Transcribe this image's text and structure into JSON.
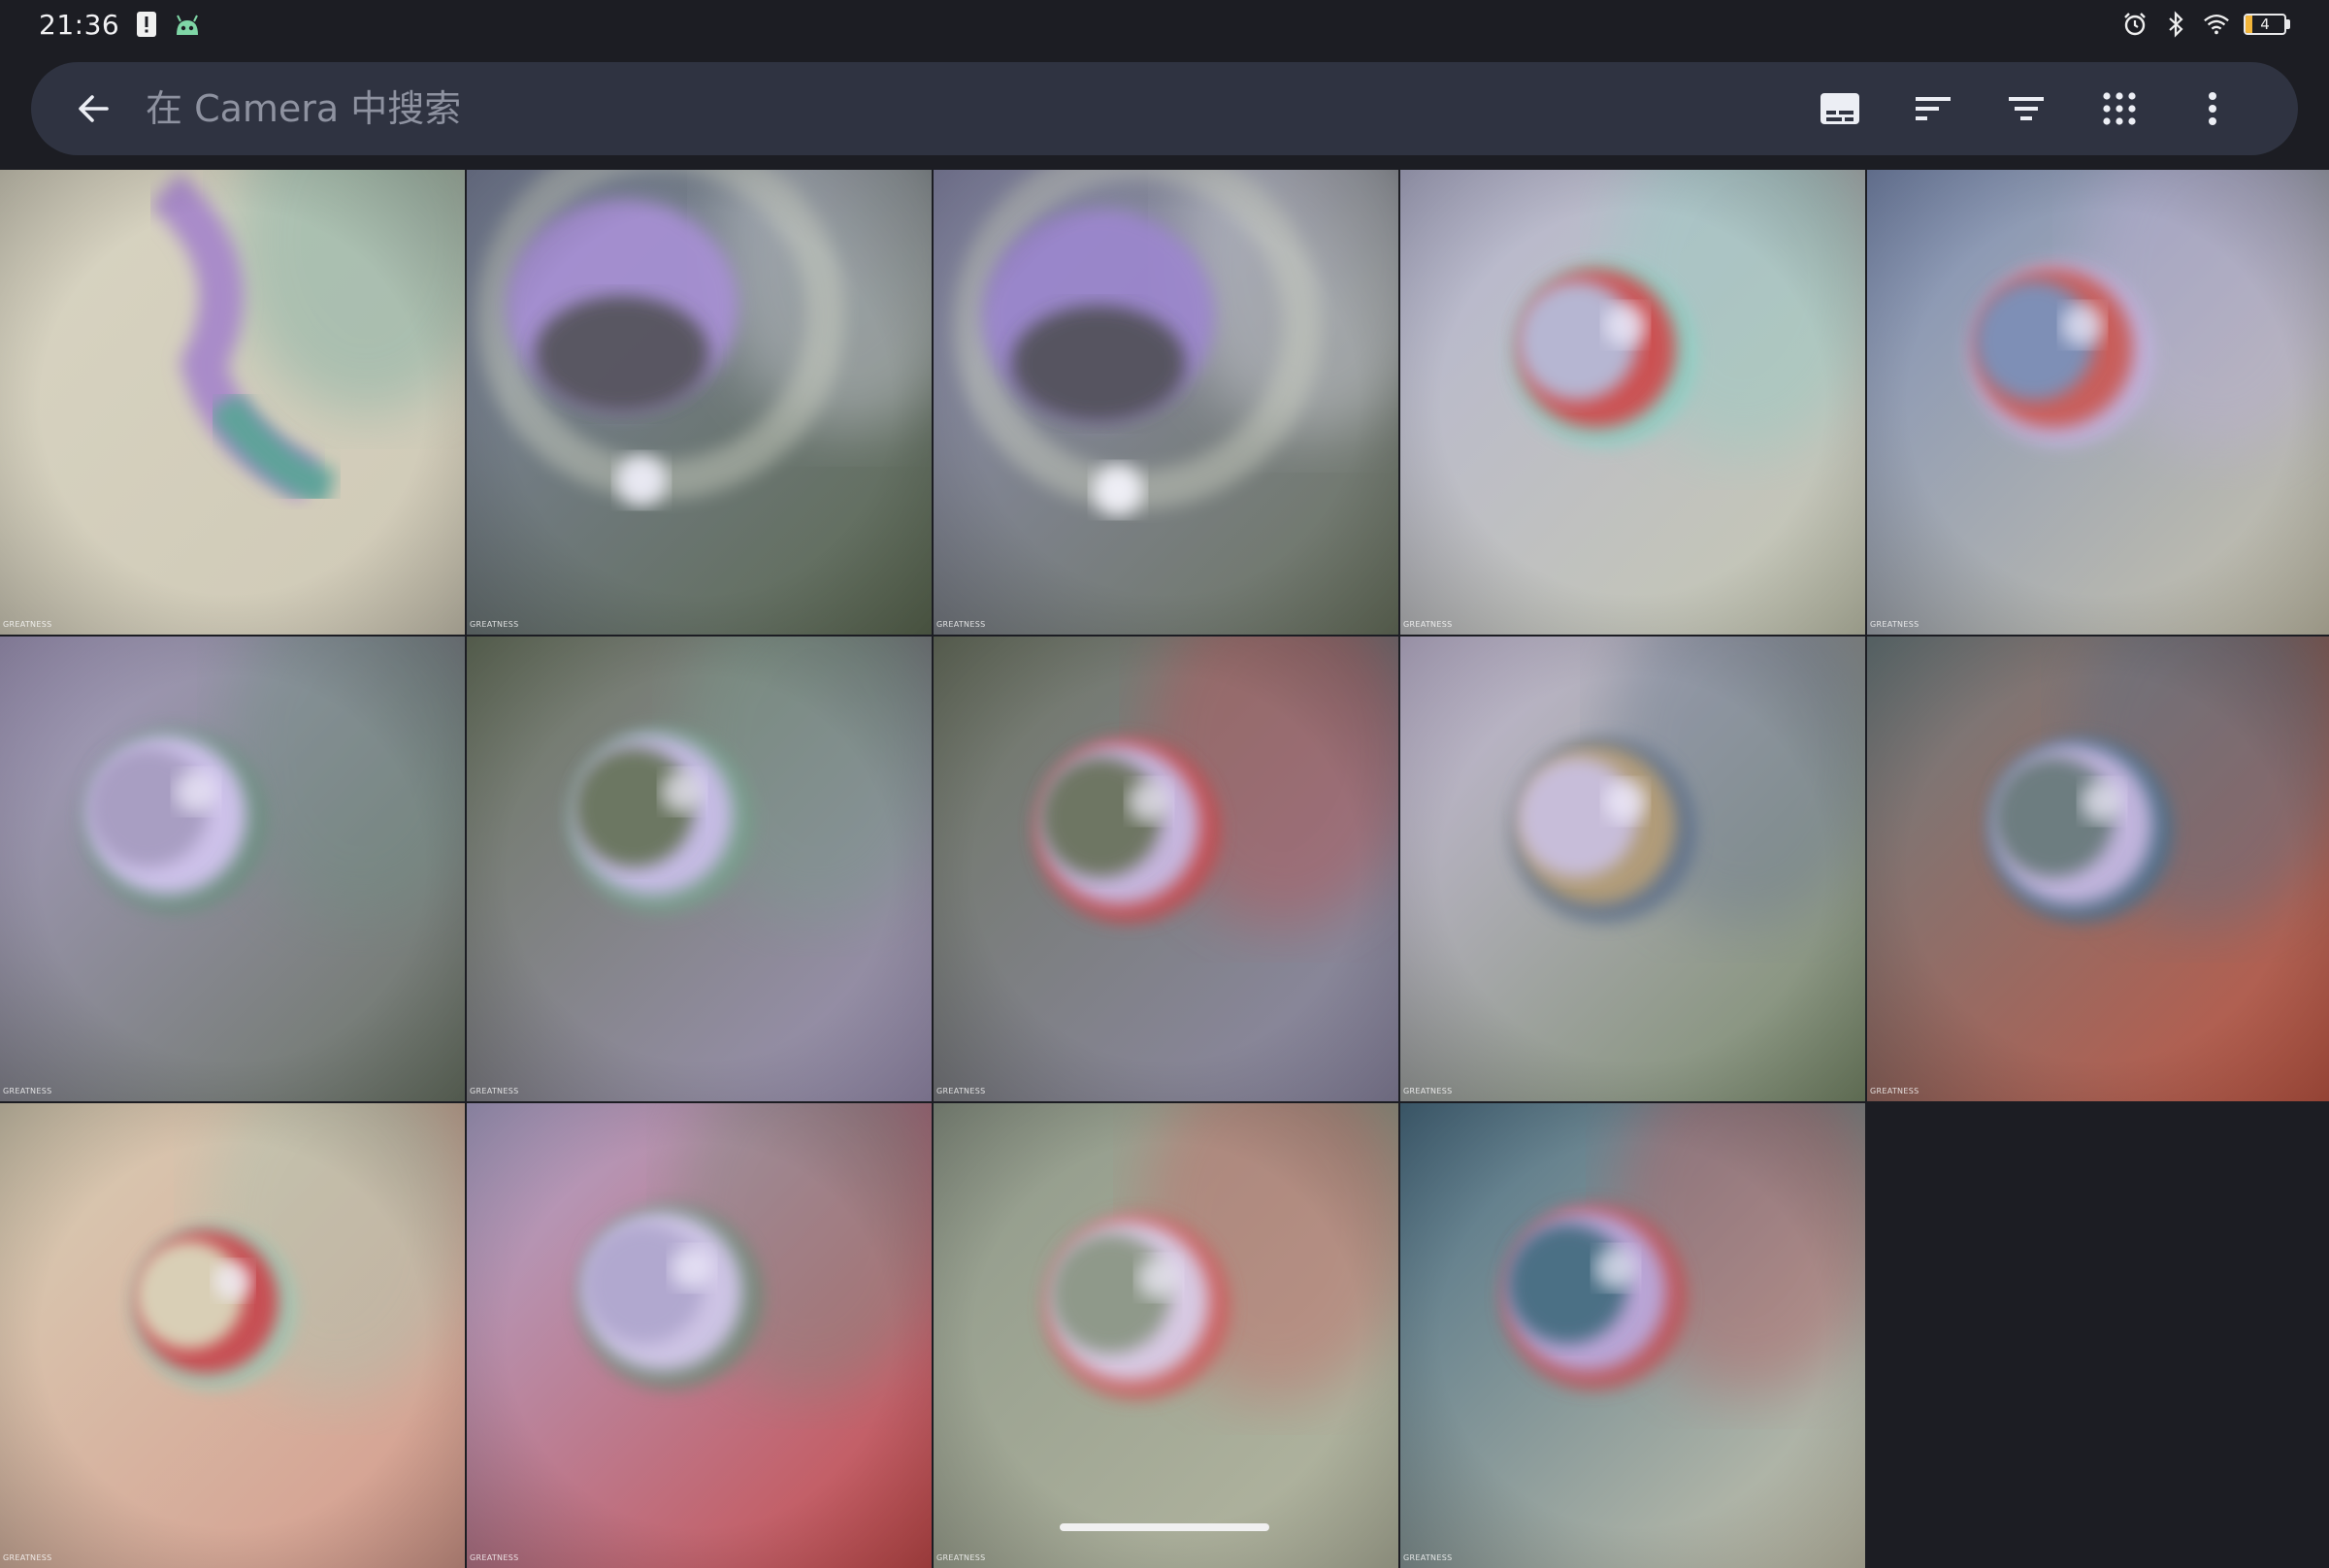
{
  "status_bar": {
    "time": "21:36",
    "left_icons": [
      "alert-icon",
      "android-robot-icon"
    ],
    "right_icons": [
      "alarm-icon",
      "bluetooth-icon",
      "wifi-icon"
    ],
    "battery_level": "4",
    "battery_color": "#f2b53a"
  },
  "search": {
    "placeholder": "在 Camera 中搜索",
    "value": "",
    "back_icon": "arrow-back-icon"
  },
  "toolbar": {
    "icons": [
      "subtitles-icon",
      "sort-icon",
      "filter-icon",
      "grid-view-icon",
      "more-vertical-icon"
    ]
  },
  "thumbnails": [
    {
      "watermark": "GREATNESS",
      "bg": [
        "#d8d4c2",
        "#cfc9b6"
      ],
      "accent": "#a98bc9",
      "accent2": "#5fa39a"
    },
    {
      "watermark": "GREATNESS",
      "bg": [
        "#7e86a0",
        "#5d6a52"
      ],
      "accent": "#a890d6",
      "accent2": "#e8e8f2"
    },
    {
      "watermark": "GREATNESS",
      "bg": [
        "#8d8eb0",
        "#6b7460"
      ],
      "accent": "#9c86cf",
      "accent2": "#eeeef5"
    },
    {
      "watermark": "GREATNESS",
      "bg": [
        "#b6b6d2",
        "#c7c9b2"
      ],
      "accent": "#cf4b4e",
      "accent2": "#8ad0c4"
    },
    {
      "watermark": "GREATNESS",
      "bg": [
        "#7e8fb6",
        "#c9c4ae"
      ],
      "accent": "#c95a55",
      "accent2": "#c3b2e0"
    },
    {
      "watermark": "GREATNESS",
      "bg": [
        "#a89ec2",
        "#6b7566"
      ],
      "accent": "#d2c4ef",
      "accent2": "#6c9080"
    },
    {
      "watermark": "GREATNESS",
      "bg": [
        "#6c7762",
        "#9e93b5"
      ],
      "accent": "#c9bde8",
      "accent2": "#78a08c"
    },
    {
      "watermark": "GREATNESS",
      "bg": [
        "#6e7664",
        "#8f8aa6"
      ],
      "accent": "#c6bbe4",
      "accent2": "#c9484d"
    },
    {
      "watermark": "GREATNESS",
      "bg": [
        "#c7bdd9",
        "#7b8c6c"
      ],
      "accent": "#b59e78",
      "accent2": "#5d6f8a"
    },
    {
      "watermark": "GREATNESS",
      "bg": [
        "#6d7d80",
        "#c25845"
      ],
      "accent": "#c6b8e1",
      "accent2": "#4c6f8c"
    },
    {
      "watermark": "GREATNESS",
      "bg": [
        "#d9cfb6",
        "#d59a8c"
      ],
      "accent": "#c94a4f",
      "accent2": "#9fc6b4"
    },
    {
      "watermark": "GREATNESS",
      "bg": [
        "#b1a8cf",
        "#c84c4c"
      ],
      "accent": "#d2c7ea",
      "accent2": "#6e8a78"
    },
    {
      "watermark": "GREATNESS",
      "bg": [
        "#8f998a",
        "#b5b7a1"
      ],
      "accent": "#d8cfe9",
      "accent2": "#cf5a5c"
    },
    {
      "watermark": "GREATNESS",
      "bg": [
        "#4b6f85",
        "#c9c6b0"
      ],
      "accent": "#b9a9dc",
      "accent2": "#c34f55"
    }
  ]
}
